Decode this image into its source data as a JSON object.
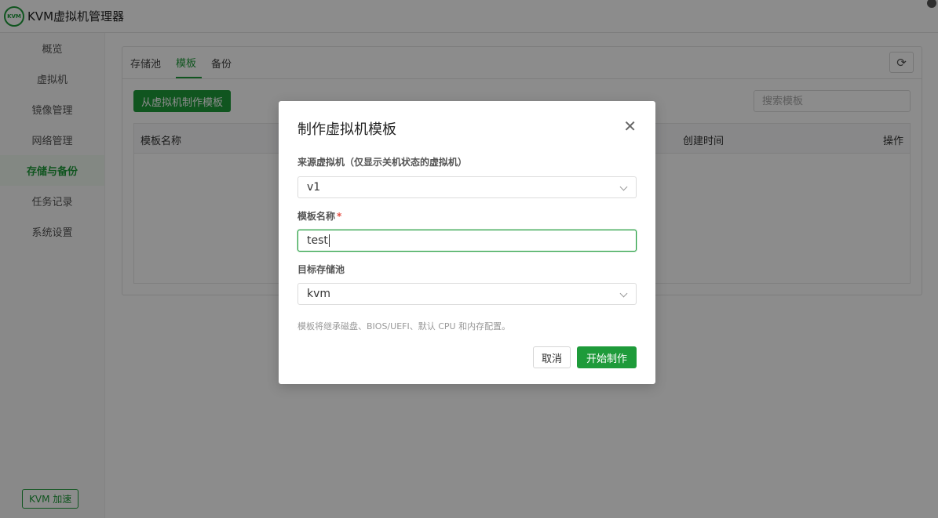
{
  "app": {
    "logo_text": "KVM",
    "title": "KVM虚拟机管理器"
  },
  "sidebar": {
    "items": [
      {
        "label": "概览"
      },
      {
        "label": "虚拟机"
      },
      {
        "label": "镜像管理"
      },
      {
        "label": "网络管理"
      },
      {
        "label": "存储与备份",
        "active": true
      },
      {
        "label": "任务记录"
      },
      {
        "label": "系统设置"
      }
    ],
    "accel_label": "KVM 加速"
  },
  "main": {
    "tabs": [
      {
        "label": "存储池"
      },
      {
        "label": "模板",
        "active": true
      },
      {
        "label": "备份"
      }
    ],
    "refresh_icon": "refresh-icon",
    "make_button": "从虚拟机制作模板",
    "search_placeholder": "搜索模板",
    "table": {
      "columns": [
        "模板名称",
        "创建时间",
        "操作"
      ]
    }
  },
  "modal": {
    "title": "制作虚拟机模板",
    "source_label": "来源虚拟机（仅显示关机状态的虚拟机）",
    "source_value": "v1",
    "name_label": "模板名称",
    "required_mark": "*",
    "name_value": "test",
    "pool_label": "目标存储池",
    "pool_value": "kvm",
    "hint": "模板将继承磁盘、BIOS/UEFI、默认 CPU 和内存配置。",
    "cancel": "取消",
    "confirm": "开始制作"
  },
  "colors": {
    "accent": "#1e9b3a",
    "required": "#e54d42"
  }
}
